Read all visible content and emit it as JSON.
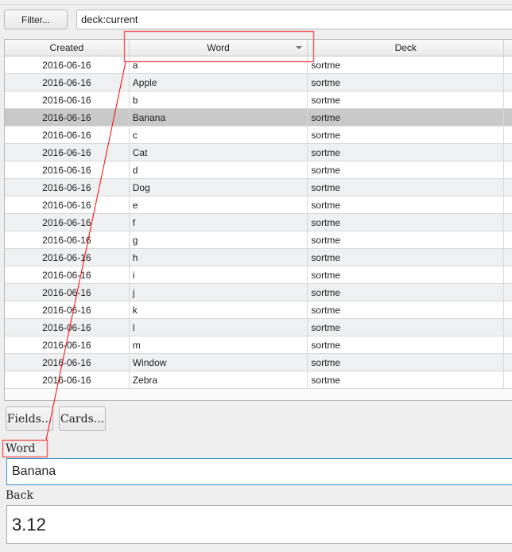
{
  "toolbar": {
    "filter_label": "Filter...",
    "search_value": "deck:current"
  },
  "table": {
    "columns": [
      "Created",
      "Word",
      "Deck"
    ],
    "rows": [
      [
        "2016-06-16",
        "a",
        "sortme"
      ],
      [
        "2016-06-16",
        "Apple",
        "sortme"
      ],
      [
        "2016-06-16",
        "b",
        "sortme"
      ],
      [
        "2016-06-16",
        "Banana",
        "sortme"
      ],
      [
        "2016-06-16",
        "c",
        "sortme"
      ],
      [
        "2016-06-16",
        "Cat",
        "sortme"
      ],
      [
        "2016-06-16",
        "d",
        "sortme"
      ],
      [
        "2016-06-16",
        "Dog",
        "sortme"
      ],
      [
        "2016-06-16",
        "e",
        "sortme"
      ],
      [
        "2016-06-16",
        "f",
        "sortme"
      ],
      [
        "2016-06-16",
        "g",
        "sortme"
      ],
      [
        "2016-06-16",
        "h",
        "sortme"
      ],
      [
        "2016-06-16",
        "i",
        "sortme"
      ],
      [
        "2016-06-16",
        "j",
        "sortme"
      ],
      [
        "2016-06-16",
        "k",
        "sortme"
      ],
      [
        "2016-06-16",
        "l",
        "sortme"
      ],
      [
        "2016-06-16",
        "m",
        "sortme"
      ],
      [
        "2016-06-16",
        "Window",
        "sortme"
      ],
      [
        "2016-06-16",
        "Zebra",
        "sortme"
      ]
    ],
    "selected_index": 3
  },
  "editor": {
    "fields_label": "Fields...",
    "cards_label": "Cards...",
    "word_label": "Word",
    "word_value": "Banana",
    "back_label": "Back",
    "back_value": "3.12"
  },
  "annotation_color": "#ff0000"
}
